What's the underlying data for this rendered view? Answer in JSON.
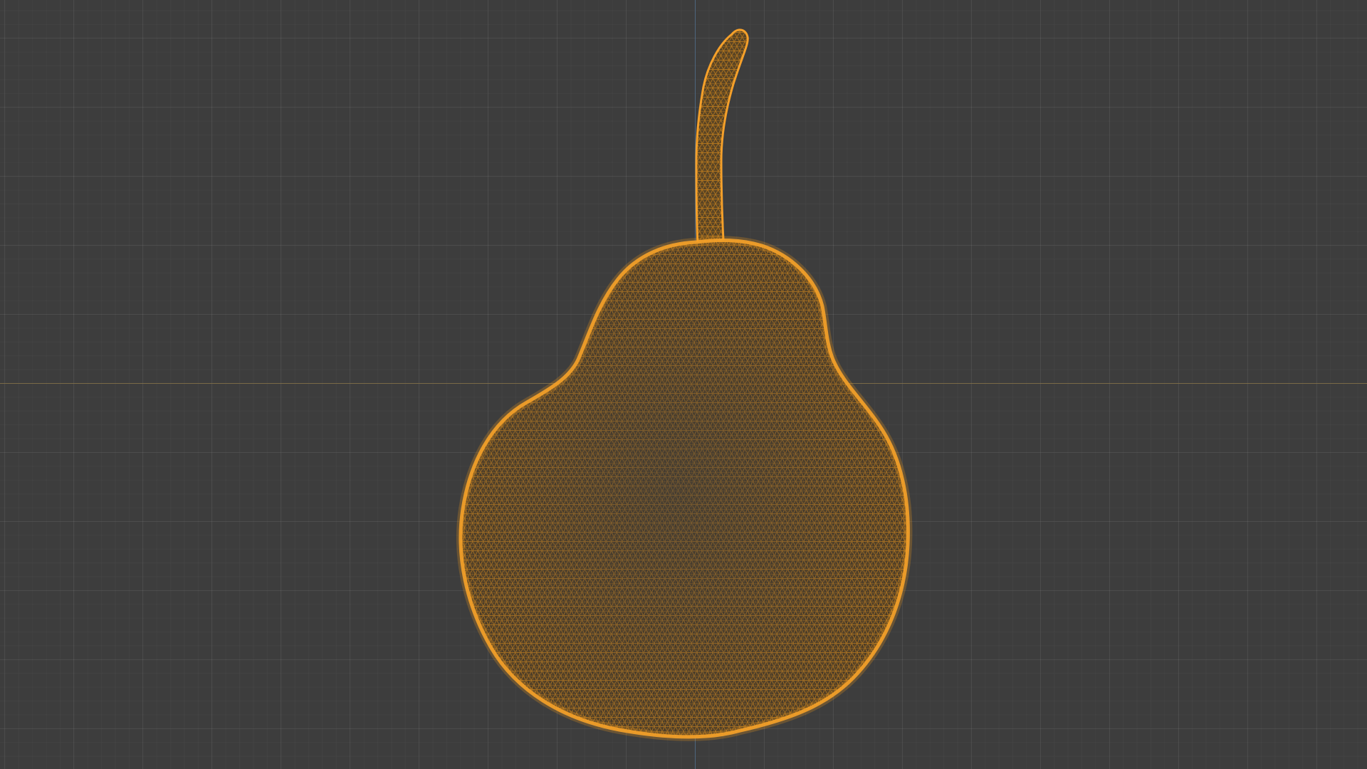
{
  "viewport": {
    "background_color": "#3d3d3d",
    "grid_color": "#474747",
    "x_axis_color": "#8a7445",
    "y_axis_color": "#4f6d8f"
  },
  "object": {
    "shading": "wireframe",
    "wire_color": "#f39a1c",
    "selected": true
  }
}
